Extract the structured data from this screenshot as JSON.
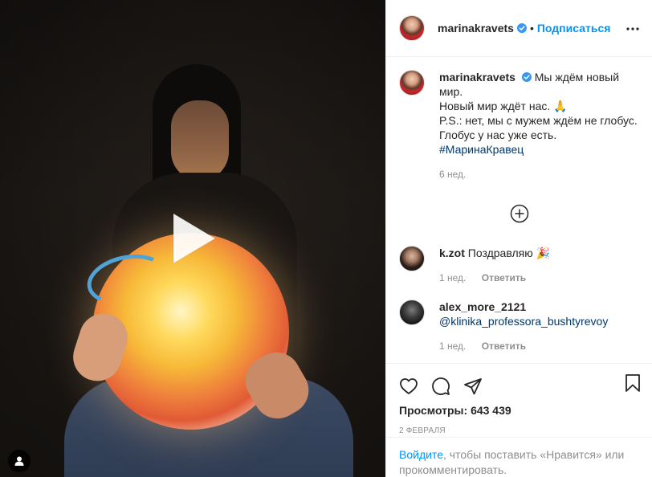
{
  "post": {
    "author": "marinakravets",
    "follow_label": "Подписаться",
    "separator": "•",
    "caption_lines": [
      "Мы ждём новый мир.",
      "Новый мир ждёт нас. 🙏",
      "P.S.: нет, мы с мужем ждём не глобус. Глобус у нас уже есть."
    ],
    "hashtag": "#МаринаКравец",
    "caption_age": "6 нед.",
    "views_label": "Просмотры:",
    "views_count": "643 439",
    "date": "2 ФЕВРАЛЯ"
  },
  "comments": [
    {
      "user": "k.zot",
      "text": "Поздравляю 🎉",
      "age": "1 нед.",
      "reply_label": "Ответить"
    },
    {
      "user": "alex_more_2121",
      "mention": "@klinika_professora_bushtyrevoy",
      "age": "1 нед.",
      "reply_label": "Ответить"
    }
  ],
  "login_prompt": {
    "link": "Войдите",
    "rest": ", чтобы поставить «Нравится» или прокомментировать."
  },
  "icons": {
    "verified": "verified-badge-icon",
    "more": "more-options-icon",
    "load_more": "plus-circle-icon",
    "like": "heart-icon",
    "comment": "comment-bubble-icon",
    "share": "paper-plane-icon",
    "save": "bookmark-icon",
    "play": "play-icon",
    "tagged_user": "user-icon"
  },
  "colors": {
    "accent": "#0095f6",
    "verified": "#3897f0",
    "link_dark": "#00376b",
    "muted": "#8e8e8e"
  }
}
